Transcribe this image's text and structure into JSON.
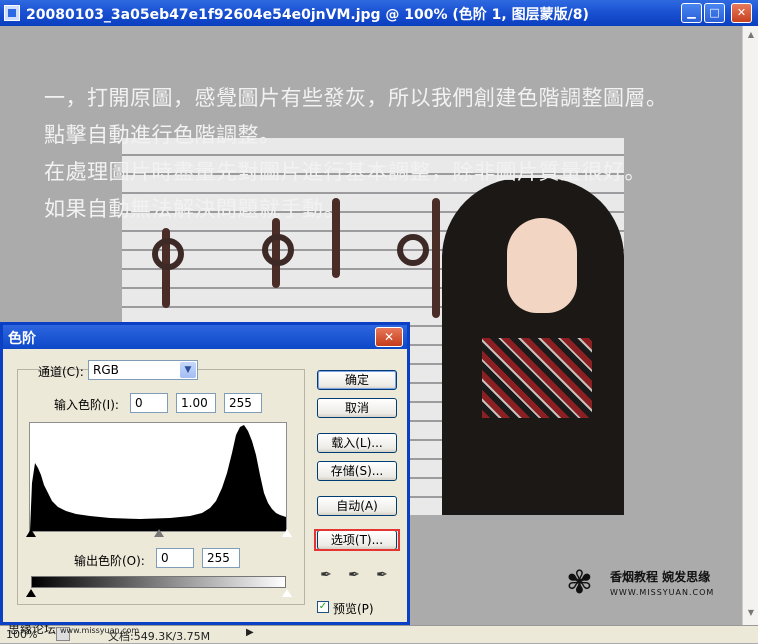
{
  "window": {
    "title": "20080103_3a05eb47e1f92604e54e0jnVM.jpg @ 100% (色阶 1, 图层蒙版/8)",
    "min_glyph": "▁",
    "max_glyph": "□",
    "close_glyph": "✕"
  },
  "caption": {
    "line1": "一，打開原圖，感覺圖片有些發灰，所以我們創建色階調整圖層。",
    "line2": "點擊自動進行色階調整。",
    "line3": "在處理圖片時盡量先對圖片進行基本調整，除非圖片質量很好。",
    "line4": "如果自動無法解決問題就手動。"
  },
  "watermark": {
    "line1": "香烟教程  婉发思缘",
    "line2": "WWW.MISSYUAN.COM",
    "logo_glyph": "✾"
  },
  "status": {
    "zoom": "100%",
    "doc": "文档:549.3K/3.75M",
    "arrow": "▶",
    "forum": "思缘论坛",
    "forum_url": "www.missyuan.com"
  },
  "dialog": {
    "title": "色阶",
    "close_glyph": "✕",
    "channel_label": "通道(C):",
    "channel_value": "RGB",
    "input_label": "输入色阶(I):",
    "input_black": "0",
    "input_gamma": "1.00",
    "input_white": "255",
    "output_label": "输出色阶(O):",
    "output_black": "0",
    "output_white": "255",
    "buttons": {
      "ok": "确定",
      "cancel": "取消",
      "load": "载入(L)...",
      "save": "存储(S)...",
      "auto": "自动(A)",
      "options": "选项(T)..."
    },
    "preview_label": "预览(P)",
    "preview_checked": true
  },
  "colors": {
    "titlebar": "#1b52d3",
    "dialog_bg": "#ece9d8",
    "highlight": "#e43434"
  }
}
